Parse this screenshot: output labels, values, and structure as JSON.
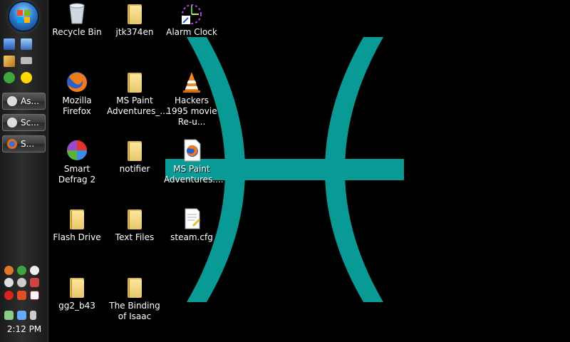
{
  "colors": {
    "wallpaper_bg": "#000000",
    "pisces_symbol": "#0a9a96",
    "taskbar": "#262626",
    "label_text": "#ffffff"
  },
  "taskbar": {
    "task_buttons": [
      {
        "label": "As...",
        "icon": "steam-icon"
      },
      {
        "label": "Sc...",
        "icon": "steam-icon"
      },
      {
        "label": "S...",
        "icon": "firefox-icon"
      }
    ],
    "quick_launch": [
      "show-desktop-icon",
      "switch-windows-icon",
      "pencil-icon",
      "keyboard-icon",
      "utorrent-icon",
      "messenger-icon"
    ],
    "tray_icons": [
      "firefox-icon",
      "utorrent-icon",
      "messenger-icon",
      "clock-icon",
      "steam-icon",
      "network-icon",
      "record-icon",
      "speaker-mute-icon",
      "gmail-icon",
      "battery-icon",
      "monitor-icon",
      "volume-icon"
    ],
    "clock": "2:12 PM"
  },
  "desktop": {
    "icons": [
      {
        "label": "Recycle Bin",
        "type": "recycle-bin"
      },
      {
        "label": "jtk374en",
        "type": "folder"
      },
      {
        "label": "Alarm Clock",
        "type": "alarm-clock"
      },
      {
        "label": "Mozilla Firefox",
        "type": "firefox"
      },
      {
        "label": "MS Paint Adventures_...",
        "type": "folder"
      },
      {
        "label": "Hackers 1995 movie Re-u...",
        "type": "vlc"
      },
      {
        "label": "Smart Defrag 2",
        "type": "defrag"
      },
      {
        "label": "notifier",
        "type": "folder"
      },
      {
        "label": "MS Paint Adventures....",
        "type": "firefox-doc"
      },
      {
        "label": "Flash Drive",
        "type": "folder"
      },
      {
        "label": "Text Files",
        "type": "folder"
      },
      {
        "label": "steam.cfg",
        "type": "text-doc"
      },
      {
        "label": "gg2_b43",
        "type": "folder"
      },
      {
        "label": "The Binding of Isaac",
        "type": "folder"
      }
    ]
  }
}
